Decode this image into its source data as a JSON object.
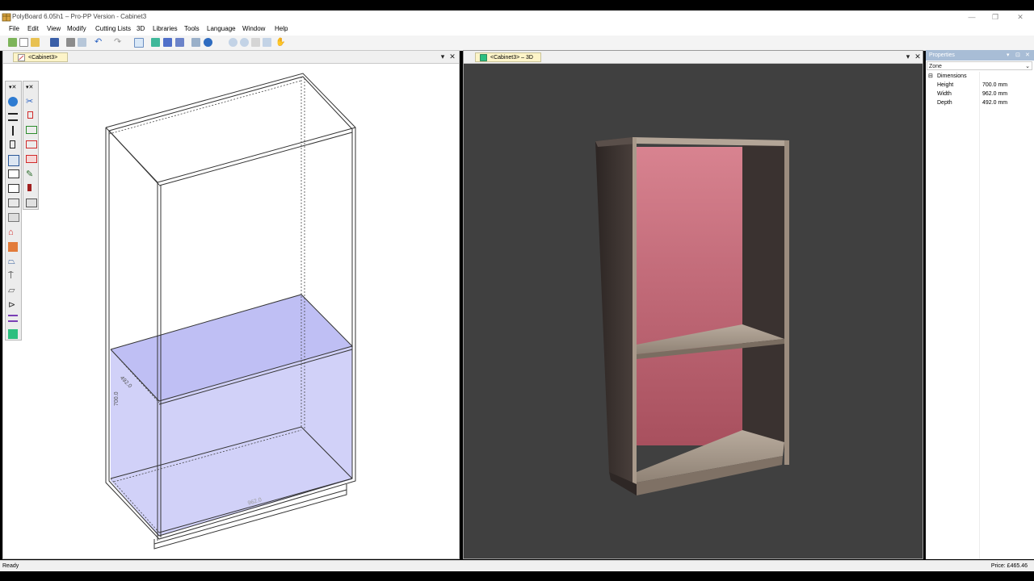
{
  "window": {
    "title": "PolyBoard 6.05h1 – Pro-PP Version - Cabinet3",
    "controls": {
      "minimize": "—",
      "restore": "❐",
      "close": "✕"
    }
  },
  "menu": [
    "File",
    "Edit",
    "View",
    "Modify",
    "Cutting Lists",
    "3D",
    "Libraries",
    "Tools",
    "Language",
    "Window",
    "Help"
  ],
  "left_pane": {
    "tab_label": "<Cabinet3>",
    "dropdown_icon": "▾",
    "close_icon": "✕",
    "dimension_labels": {
      "height": "700.0",
      "depth": "492.0",
      "width": "962.0"
    }
  },
  "right_pane": {
    "tab_label": "<Cabinet3> – 3D",
    "dropdown_icon": "▾",
    "close_icon": "✕"
  },
  "properties": {
    "header": "Properties",
    "header_icons": [
      "▾",
      "⊡",
      "✕"
    ],
    "selection": "Zone",
    "section": "Dimensions",
    "section_toggle": "⊟",
    "rows": [
      {
        "label": "Height",
        "value": "700.0 mm"
      },
      {
        "label": "Width",
        "value": "962.0 mm"
      },
      {
        "label": "Depth",
        "value": "492.0 mm"
      }
    ]
  },
  "status": {
    "text": "Ready",
    "price": "Price: £465.46"
  },
  "colors": {
    "viewport_bg": "#404040",
    "highlight_zone": "#c8c8f8",
    "back_panel": "#c96a78",
    "wood_dark": "#3b3330",
    "wood_light": "#a89a8c",
    "tab_bg": "#fdf4c8"
  }
}
